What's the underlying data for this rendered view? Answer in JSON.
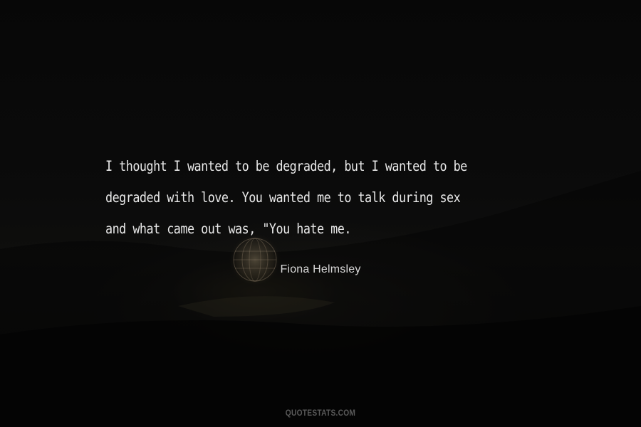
{
  "quote": {
    "lines": [
      "I thought I wanted to be degraded, but I wanted to be",
      "degraded with love. You wanted me to talk during sex",
      "and what came out was, \"You hate me."
    ]
  },
  "author": "Fiona Helmsley",
  "watermark": "QUOTESTATS.COM",
  "colors": {
    "background": "#0a0a0a",
    "quote_text": "#e9e9e9",
    "author_text": "#d8d8d8",
    "watermark_text": "#5a5a5a"
  }
}
